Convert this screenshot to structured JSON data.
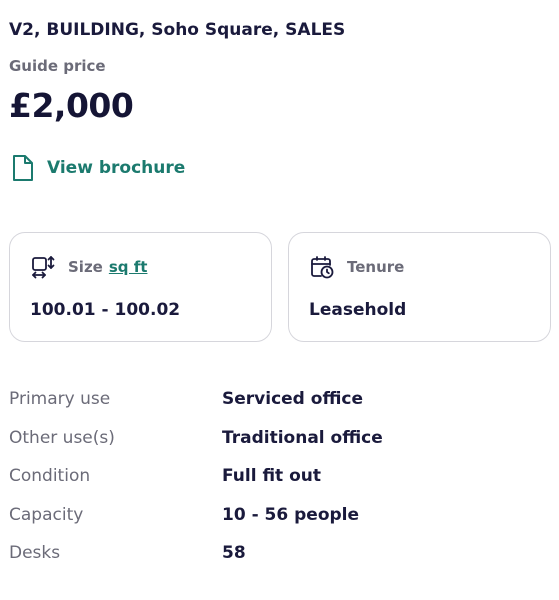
{
  "header": {
    "address": "V2, BUILDING, Soho Square, SALES",
    "guide_price_label": "Guide price",
    "price": "£2,000"
  },
  "brochure": {
    "label": "View brochure",
    "icon": "document-icon"
  },
  "cards": {
    "size": {
      "icon": "resize-icon",
      "title": "Size",
      "unit": "sq ft",
      "value": "100.01 - 100.02"
    },
    "tenure": {
      "icon": "calendar-clock-icon",
      "title": "Tenure",
      "value": "Leasehold"
    }
  },
  "details": [
    {
      "label": "Primary use",
      "value": "Serviced office"
    },
    {
      "label": "Other use(s)",
      "value": "Traditional office"
    },
    {
      "label": "Condition",
      "value": "Full fit out"
    },
    {
      "label": "Capacity",
      "value": "10 - 56 people"
    },
    {
      "label": "Desks",
      "value": "58"
    }
  ],
  "colors": {
    "text_primary": "#1a1a3c",
    "text_secondary": "#6b6b78",
    "accent": "#1b7a6e",
    "border": "#d6d6dc"
  }
}
